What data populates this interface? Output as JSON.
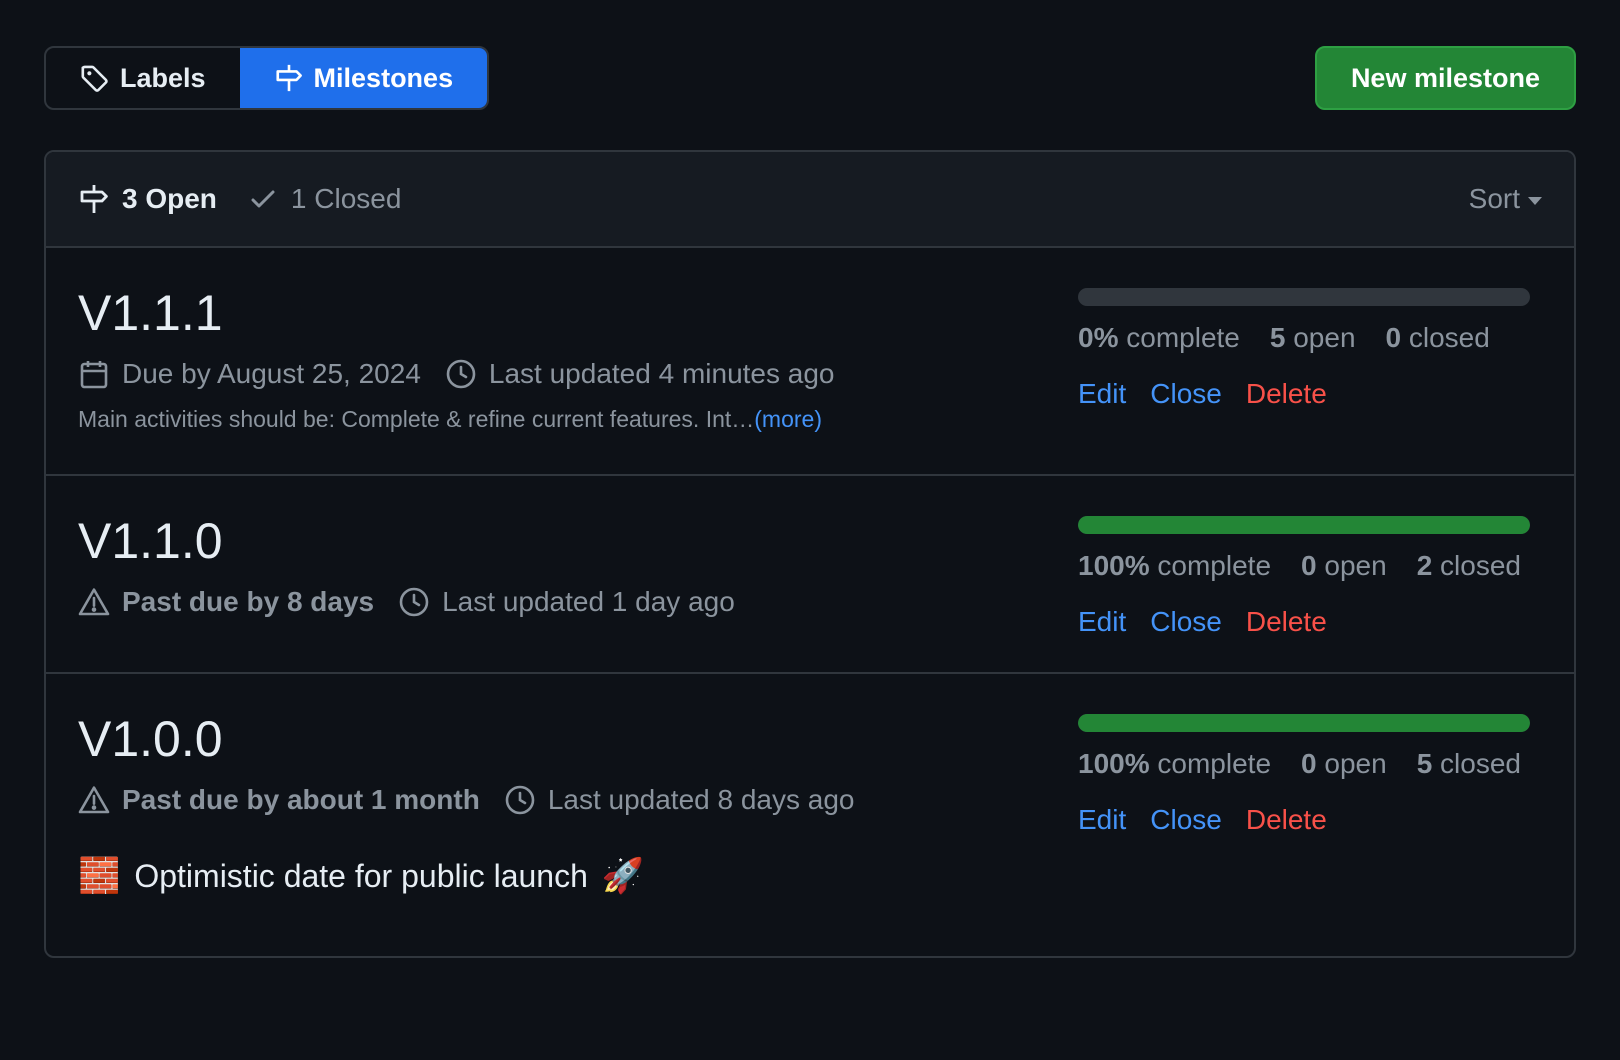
{
  "tabs": {
    "labels": "Labels",
    "milestones": "Milestones"
  },
  "new_milestone_button": "New milestone",
  "header": {
    "open_label": "3 Open",
    "closed_label": "1 Closed",
    "sort_label": "Sort"
  },
  "colors": {
    "accent": "#1f6feb",
    "success": "#238636",
    "link": "#4493f8",
    "danger": "#f85149",
    "background": "#0d1117"
  },
  "milestones": [
    {
      "title": "V1.1.1",
      "due_text": "Due by August 25, 2024",
      "updated_text": "Last updated 4 minutes ago",
      "description": "Main activities should be: Complete & refine current features. Int…",
      "more_link": "(more)",
      "progress_percent": 0,
      "percent_value": "0%",
      "complete_word": "complete",
      "open_count": "5",
      "open_word": "open",
      "closed_count": "0",
      "closed_word": "closed",
      "edit": "Edit",
      "close": "Close",
      "delete": "Delete"
    },
    {
      "title": "V1.1.0",
      "due_text": "Past due by 8 days",
      "updated_text": "Last updated 1 day ago",
      "progress_percent": 100,
      "percent_value": "100%",
      "complete_word": "complete",
      "open_count": "0",
      "open_word": "open",
      "closed_count": "2",
      "closed_word": "closed",
      "edit": "Edit",
      "close": "Close",
      "delete": "Delete"
    },
    {
      "title": "V1.0.0",
      "due_text": "Past due by about 1 month",
      "updated_text": "Last updated 8 days ago",
      "description_emoji_start": "🧱",
      "description": "Optimistic date for public launch",
      "description_emoji_end": "🚀",
      "progress_percent": 100,
      "percent_value": "100%",
      "complete_word": "complete",
      "open_count": "0",
      "open_word": "open",
      "closed_count": "5",
      "closed_word": "closed",
      "edit": "Edit",
      "close": "Close",
      "delete": "Delete"
    }
  ]
}
